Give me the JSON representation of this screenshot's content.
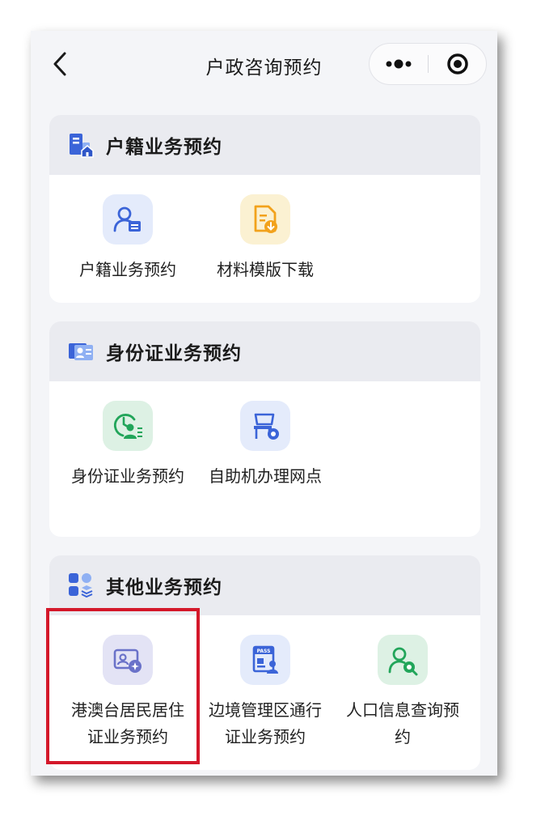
{
  "nav": {
    "title": "户政咨询预约"
  },
  "sections": [
    {
      "title": "户籍业务预约",
      "items": [
        {
          "label": "户籍业务预约",
          "icon": "person-card-icon"
        },
        {
          "label": "材料模版下载",
          "icon": "document-download-icon"
        }
      ]
    },
    {
      "title": "身份证业务预约",
      "items": [
        {
          "label": "身份证业务预约",
          "icon": "clock-person-icon"
        },
        {
          "label": "自助机办理网点",
          "icon": "kiosk-machine-icon"
        }
      ]
    },
    {
      "title": "其他业务预约",
      "items": [
        {
          "label": "港澳台居民居住证业务预约",
          "icon": "residence-permit-icon"
        },
        {
          "label": "边境管理区通行证业务预约",
          "icon": "pass-card-icon",
          "badge": "PASS"
        },
        {
          "label": "人口信息查询预约",
          "icon": "person-search-icon"
        }
      ]
    }
  ],
  "colors": {
    "highlight": "#d4182a",
    "blue_accent": "#3b64d8",
    "green_accent": "#22a55a",
    "orange_accent": "#f2a21c",
    "purple_accent": "#6a72c9"
  }
}
